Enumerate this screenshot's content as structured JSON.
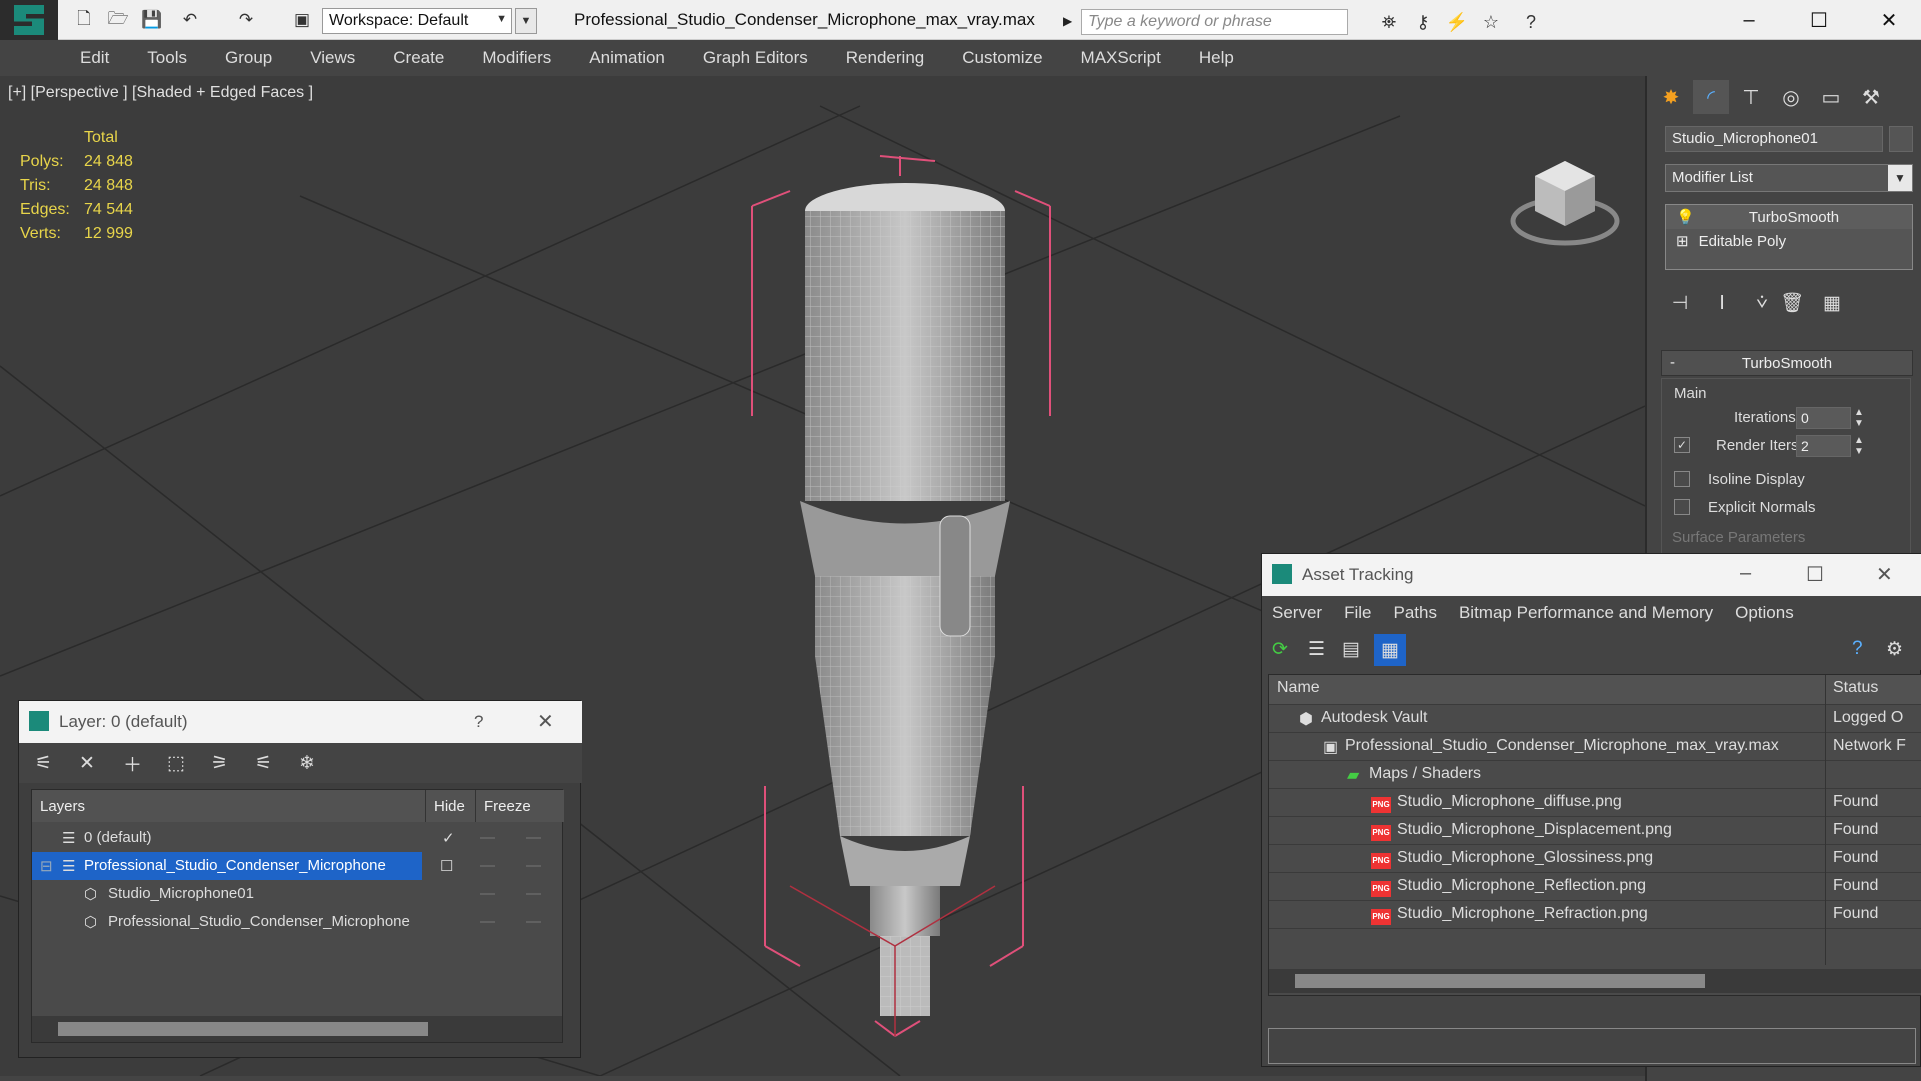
{
  "titlebar": {
    "workspace": "Workspace: Default",
    "file_title": "Professional_Studio_Condenser_Microphone_max_vray.max",
    "search_placeholder": "Type a keyword or phrase"
  },
  "menu": [
    "Edit",
    "Tools",
    "Group",
    "Views",
    "Create",
    "Modifiers",
    "Animation",
    "Graph Editors",
    "Rendering",
    "Customize",
    "MAXScript",
    "Help"
  ],
  "viewport": {
    "label": "[+] [Perspective ] [Shaded + Edged Faces ]",
    "stats_header": "Total",
    "stats": [
      {
        "k": "Polys:",
        "v": "24 848"
      },
      {
        "k": "Tris:",
        "v": "24 848"
      },
      {
        "k": "Edges:",
        "v": "74 544"
      },
      {
        "k": "Verts:",
        "v": "12 999"
      }
    ]
  },
  "command_panel": {
    "object_name": "Studio_Microphone01",
    "modifier_list": "Modifier List",
    "stack": [
      "TurboSmooth",
      "Editable Poly"
    ],
    "rollout_title": "TurboSmooth",
    "rollout_minus": "-",
    "main_group": "Main",
    "iterations_label": "Iterations:",
    "iterations_value": "0",
    "render_iters_label": "Render Iters:",
    "render_iters_value": "2",
    "isoline": "Isoline Display",
    "explicit_normals": "Explicit Normals",
    "surface_params": "Surface Parameters"
  },
  "layer_window": {
    "title": "Layer: 0 (default)",
    "help": "?",
    "col_layers": "Layers",
    "col_hide": "Hide",
    "col_freeze": "Freeze",
    "rows": [
      {
        "name": "0 (default)"
      },
      {
        "name": "Professional_Studio_Condenser_Microphone"
      },
      {
        "name": "Studio_Microphone01"
      },
      {
        "name": "Professional_Studio_Condenser_Microphone"
      }
    ]
  },
  "asset_window": {
    "title": "Asset Tracking",
    "menu": [
      "Server",
      "File",
      "Paths",
      "Bitmap Performance and Memory",
      "Options"
    ],
    "col_name": "Name",
    "col_status": "Status",
    "rows": [
      {
        "name": "Autodesk Vault",
        "status": "Logged O"
      },
      {
        "name": "Professional_Studio_Condenser_Microphone_max_vray.max",
        "status": "Network F"
      },
      {
        "name": "Maps / Shaders",
        "status": ""
      },
      {
        "name": "Studio_Microphone_diffuse.png",
        "status": "Found"
      },
      {
        "name": "Studio_Microphone_Displacement.png",
        "status": "Found"
      },
      {
        "name": "Studio_Microphone_Glossiness.png",
        "status": "Found"
      },
      {
        "name": "Studio_Microphone_Reflection.png",
        "status": "Found"
      },
      {
        "name": "Studio_Microphone_Refraction.png",
        "status": "Found"
      }
    ]
  },
  "colors": {
    "stats": "#e8d54a",
    "selection": "#1e64c8",
    "brand": "#1b8a7a",
    "gizmo": "#e0507a"
  }
}
